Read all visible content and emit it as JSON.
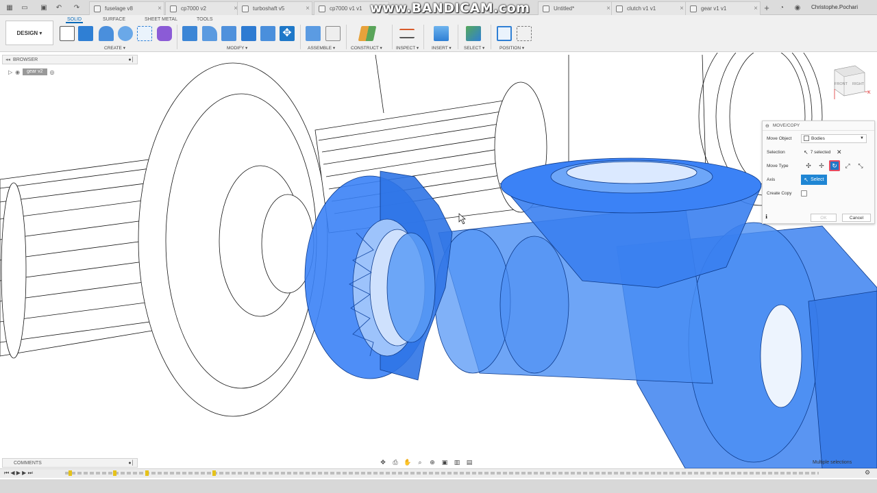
{
  "tabs": [
    {
      "label": "fuselage v8"
    },
    {
      "label": "cp7000 v2"
    },
    {
      "label": "turboshaft v5"
    },
    {
      "label": "cp7000 v1 v1"
    },
    {
      "label": "Untitled*"
    },
    {
      "label": "clutch v1 v1"
    },
    {
      "label": "gear v1 v1"
    }
  ],
  "watermark": "www.BANDICAM.com",
  "user": "Christophe.Pochari",
  "ribbon": {
    "tabs": [
      "SOLID",
      "SURFACE",
      "SHEET METAL",
      "TOOLS"
    ],
    "active_tab": "SOLID",
    "design_label": "DESIGN ▾",
    "groups": [
      "CREATE ▾",
      "MODIFY ▾",
      "ASSEMBLE ▾",
      "CONSTRUCT ▾",
      "INSPECT ▾",
      "INSERT ▾",
      "SELECT ▾",
      "POSITION ▾"
    ]
  },
  "browser": {
    "label": "BROWSER",
    "root_node": "gear v2"
  },
  "dialog": {
    "title": "MOVE/COPY",
    "move_object_label": "Move Object",
    "move_object_value": "Bodies",
    "selection_label": "Selection",
    "selection_value": "7 selected",
    "move_type_label": "Move Type",
    "axis_label": "Axis",
    "axis_button": "Select",
    "create_copy_label": "Create Copy",
    "ok_label": "OK",
    "cancel_label": "Cancel"
  },
  "comments_label": "COMMENTS",
  "status_text": "Multiple selections",
  "colors": {
    "accent": "#1f86d4",
    "selection_fill": "#3b82f6",
    "ribbon_bg": "#f0f0f0"
  }
}
